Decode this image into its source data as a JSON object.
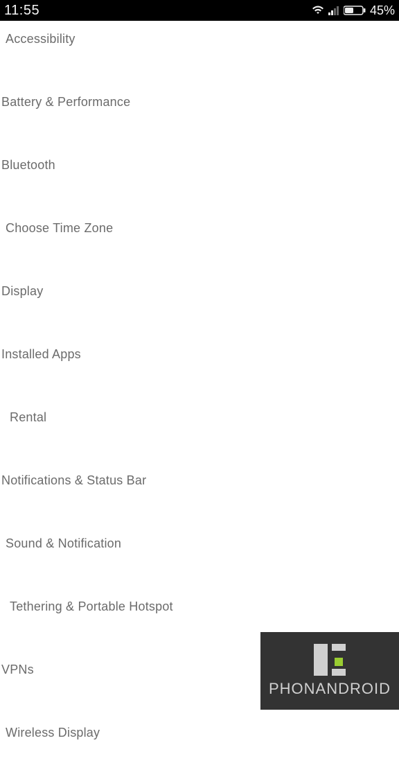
{
  "status_bar": {
    "time": "11:55",
    "battery_pct": "45%"
  },
  "settings": {
    "items": [
      {
        "label": "Accessibility",
        "indent": 1
      },
      {
        "label": "Battery & Performance",
        "indent": 0
      },
      {
        "label": "Bluetooth",
        "indent": 0
      },
      {
        "label": "Choose Time Zone",
        "indent": 1
      },
      {
        "label": "Display",
        "indent": 0
      },
      {
        "label": "Installed Apps",
        "indent": 0
      },
      {
        "label": "Rental",
        "indent": 1
      },
      {
        "label": "Notifications & Status Bar",
        "indent": 0
      },
      {
        "label": "Sound & Notification",
        "indent": 1
      },
      {
        "label": "Tethering & Portable Hotspot",
        "indent": 2
      },
      {
        "label": "VPNs",
        "indent": 0
      },
      {
        "label": "Wireless Display",
        "indent": 1
      }
    ]
  },
  "watermark": {
    "text": "PHONANDROID"
  }
}
